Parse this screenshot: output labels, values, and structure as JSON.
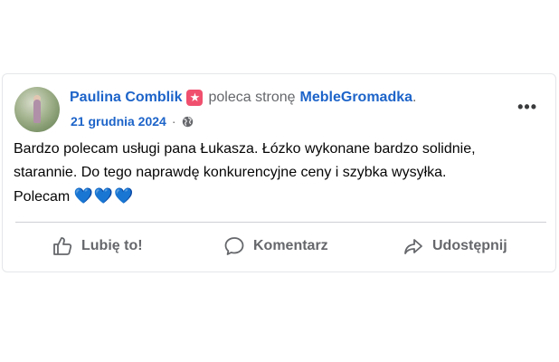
{
  "post": {
    "author": "Paulina Comblik",
    "verb": "poleca stronę",
    "page": "MebleGromadka",
    "period": ".",
    "date": "21 grudnia 2024",
    "separator": "·",
    "privacy_icon": "globe-icon",
    "more_label": "•••",
    "text_lines": [
      "Bardzo polecam usługi pana Łukasza. Łózko wykonane bardzo solidnie,",
      "starannie. Do tego naprawdę konkurencyjne ceny i szybka wysyłka.",
      "Polecam"
    ],
    "hearts": "💙💙💙"
  },
  "actions": {
    "like": "Lubię to!",
    "comment": "Komentarz",
    "share": "Udostępnij"
  },
  "colors": {
    "link_blue": "#1d64c9",
    "muted_gray": "#65676b",
    "recommend_red": "#f0506e",
    "heart_blue": "#7fd0f2"
  }
}
